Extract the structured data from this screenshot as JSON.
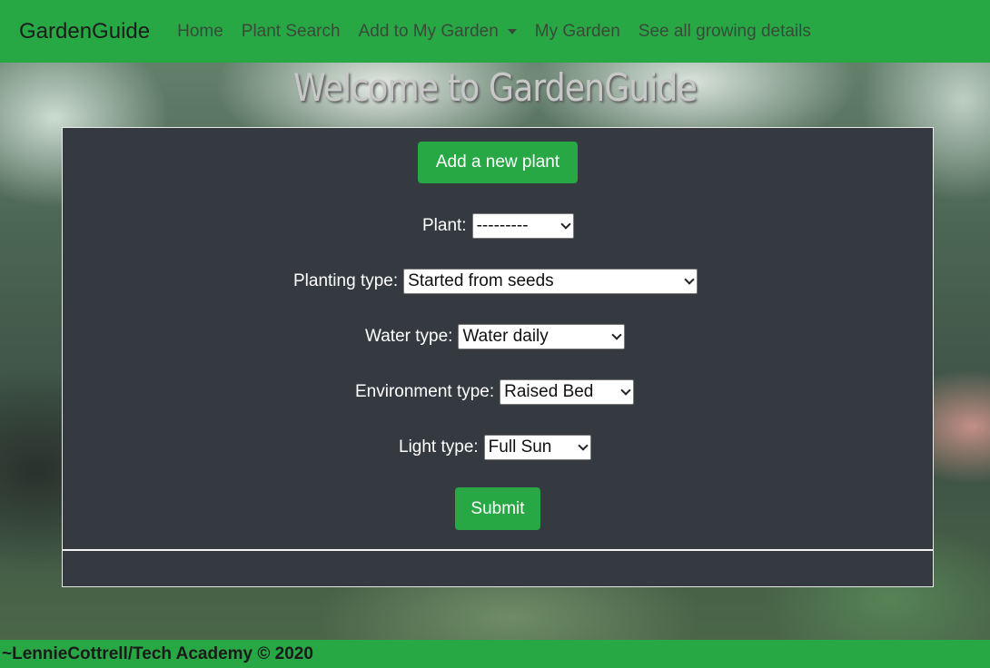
{
  "navbar": {
    "brand": "GardenGuide",
    "links": [
      {
        "label": "Home"
      },
      {
        "label": "Plant Search"
      },
      {
        "label": "Add to My Garden"
      },
      {
        "label": "My Garden"
      },
      {
        "label": "See all growing details"
      }
    ]
  },
  "heading": "Welcome to GardenGuide",
  "form": {
    "add_button": "Add a new plant",
    "plant": {
      "label": "Plant:",
      "value": "---------"
    },
    "planting_type": {
      "label": "Planting type:",
      "value": "Started from seeds"
    },
    "water_type": {
      "label": "Water type:",
      "value": "Water daily"
    },
    "environment_type": {
      "label": "Environment type:",
      "value": "Raised Bed"
    },
    "light_type": {
      "label": "Light type:",
      "value": "Full Sun"
    },
    "submit": "Submit"
  },
  "footer": {
    "text": "~LennieCottrell/Tech Academy © 2020"
  },
  "colors": {
    "navbar": "#28a745",
    "panel": "#343a40",
    "button": "#28a745"
  }
}
